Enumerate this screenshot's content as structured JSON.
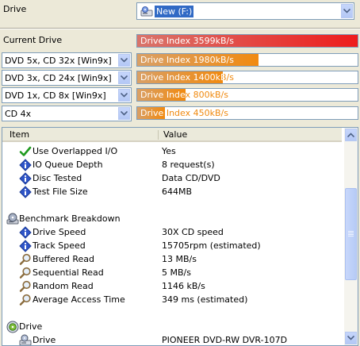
{
  "drive": {
    "label": "Drive",
    "selected": "New (F:)"
  },
  "current_drive": {
    "label": "Current Drive",
    "index_text": "Drive Index 3599kB/s",
    "fill_fraction": 1.0,
    "color": "#ee1c1c"
  },
  "presets": [
    {
      "select": "DVD 5x, CD 32x [Win9x]",
      "index_text": "Drive Index 1980kB/s",
      "fill_fraction": 0.55,
      "color": "#f18a10"
    },
    {
      "select": "DVD 3x, CD 24x [Win9x]",
      "index_text": "Drive Index 1400kB/s",
      "fill_fraction": 0.39,
      "color": "#f18a10"
    },
    {
      "select": "DVD 1x, CD 8x [Win9x]",
      "index_text": "Drive Index 800kB/s",
      "fill_fraction": 0.22,
      "color": "#f18a10"
    },
    {
      "select": "CD 4x",
      "index_text": "Drive Index 450kB/s",
      "fill_fraction": 0.125,
      "color": "#f18a10"
    }
  ],
  "table": {
    "col_item": "Item",
    "col_value": "Value",
    "rows": [
      {
        "icon": "check-icon",
        "item": "Use Overlapped I/O",
        "value": "Yes"
      },
      {
        "icon": "info-icon",
        "item": "IO Queue Depth",
        "value": "8 request(s)"
      },
      {
        "icon": "info-icon",
        "item": "Disc Tested",
        "value": "Data CD/DVD"
      },
      {
        "icon": "info-icon",
        "item": "Test File Size",
        "value": "644MB"
      },
      {
        "icon": "benchmark-icon",
        "item": "Benchmark Breakdown",
        "value": "",
        "section": true
      },
      {
        "icon": "info-icon",
        "item": "Drive Speed",
        "value": "30X CD speed"
      },
      {
        "icon": "info-icon",
        "item": "Track Speed",
        "value": "15705rpm (estimated)"
      },
      {
        "icon": "magnifier-icon",
        "item": "Buffered Read",
        "value": "13 MB/s"
      },
      {
        "icon": "magnifier-icon",
        "item": "Sequential Read",
        "value": "5 MB/s"
      },
      {
        "icon": "magnifier-icon",
        "item": "Random Read",
        "value": "1146 kB/s"
      },
      {
        "icon": "magnifier-icon",
        "item": "Average Access Time",
        "value": "349 ms (estimated)"
      },
      {
        "icon": "disc-icon",
        "item": "Drive",
        "value": "",
        "section": true
      },
      {
        "icon": "drive-icon",
        "item": "Drive",
        "value": "PIONEER DVD-RW  DVR-107D"
      }
    ]
  }
}
